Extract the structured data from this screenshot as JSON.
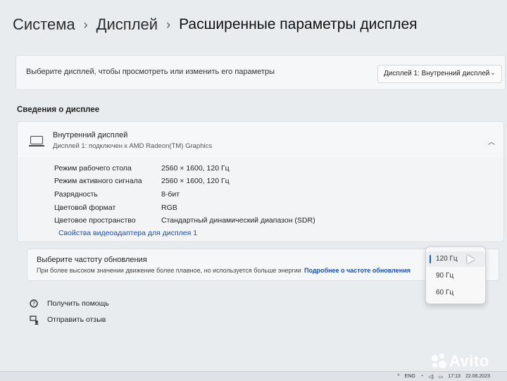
{
  "breadcrumb": {
    "level1": "Система",
    "level2": "Дисплей",
    "current": "Расширенные параметры дисплея"
  },
  "select_display": {
    "label": "Выберите дисплей, чтобы просмотреть или изменить его параметры",
    "dropdown_value": "Дисплей 1: Внутренний дисплей"
  },
  "info_section": {
    "title": "Сведения о дисплее",
    "display_name": "Внутренний дисплей",
    "display_sub": "Дисплей 1: подключен к AMD Radeon(TM) Graphics",
    "rows": [
      {
        "label": "Режим рабочего стола",
        "value": "2560 × 1600, 120 Гц"
      },
      {
        "label": "Режим активного сигнала",
        "value": "2560 × 1600, 120 Гц"
      },
      {
        "label": "Разрядность",
        "value": "8-бит"
      },
      {
        "label": "Цветовой формат",
        "value": "RGB"
      },
      {
        "label": "Цветовое пространство",
        "value": "Стандартный динамический диапазон (SDR)"
      }
    ],
    "adapter_link": "Свойства видеоадаптера для дисплея 1"
  },
  "refresh": {
    "title": "Выберите частоту обновления",
    "desc": "При более высоком значении движение более плавное, но используется больше энергии",
    "more_link": "Подробнее о частоте обновления",
    "options": [
      "120 Гц",
      "90 Гц",
      "60 Гц"
    ],
    "selected": "120 Гц"
  },
  "help": {
    "get_help": "Получить помощь",
    "feedback": "Отправить отзыв"
  },
  "taskbar": {
    "lang": "ENG",
    "time": "17:13",
    "date": "22.06.2023"
  },
  "watermark": "Avito",
  "colors": {
    "accent": "#1a5fb4",
    "link": "#1a4fb0",
    "background": "#e9ecef"
  }
}
